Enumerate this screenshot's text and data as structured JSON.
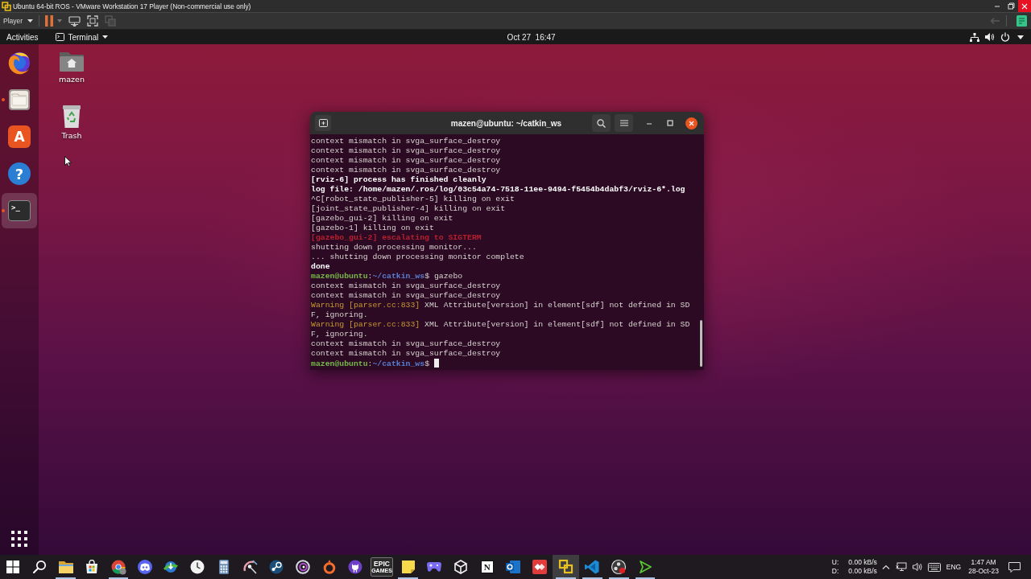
{
  "vm_window": {
    "title": "Ubuntu 64-bit ROS - VMware Workstation 17 Player (Non-commercial use only)"
  },
  "vm_toolbar": {
    "menu": "Player"
  },
  "top_bar": {
    "activities": "Activities",
    "app_menu": "Terminal",
    "clock": "Oct 27  16:47"
  },
  "dock": [
    {
      "kind": "browser",
      "running": false,
      "selected": false
    },
    {
      "kind": "files",
      "running": true,
      "selected": false
    },
    {
      "kind": "store",
      "glyph": "A",
      "running": false,
      "selected": false
    },
    {
      "kind": "help",
      "glyph": "?",
      "running": false,
      "selected": false
    },
    {
      "kind": "terminal",
      "glyph": ">_",
      "running": true,
      "selected": true
    }
  ],
  "desktop_icons": [
    {
      "kind": "home",
      "label": "mazen"
    },
    {
      "kind": "trash",
      "label": "Trash"
    }
  ],
  "terminal": {
    "title": "mazen@ubuntu: ~/catkin_ws",
    "lines": [
      {
        "segments": [
          {
            "kind": "output",
            "text": "context mismatch in svga_surface_destroy"
          }
        ]
      },
      {
        "segments": [
          {
            "kind": "output",
            "text": "context mismatch in svga_surface_destroy"
          }
        ]
      },
      {
        "segments": [
          {
            "kind": "output",
            "text": "context mismatch in svga_surface_destroy"
          }
        ]
      },
      {
        "segments": [
          {
            "kind": "output",
            "text": "context mismatch in svga_surface_destroy"
          }
        ]
      },
      {
        "segments": [
          {
            "kind": "bold",
            "text": "[rviz-6] process has finished cleanly"
          }
        ]
      },
      {
        "segments": [
          {
            "kind": "bold",
            "text": "log file: /home/mazen/.ros/log/03c54a74-7518-11ee-9494-f5454b4dabf3/rviz-6*.log"
          }
        ]
      },
      {
        "segments": [
          {
            "kind": "output",
            "text": "^C[robot_state_publisher-5] killing on exit"
          }
        ]
      },
      {
        "segments": [
          {
            "kind": "output",
            "text": "[joint_state_publisher-4] killing on exit"
          }
        ]
      },
      {
        "segments": [
          {
            "kind": "output",
            "text": "[gazebo_gui-2] killing on exit"
          }
        ]
      },
      {
        "segments": [
          {
            "kind": "output",
            "text": "[gazebo-1] killing on exit"
          }
        ]
      },
      {
        "segments": [
          {
            "kind": "error",
            "text": "[gazebo_gui-2] escalating to SIGTERM"
          }
        ]
      },
      {
        "segments": [
          {
            "kind": "output",
            "text": "shutting down processing monitor..."
          }
        ]
      },
      {
        "segments": [
          {
            "kind": "output",
            "text": "... shutting down processing monitor complete"
          }
        ]
      },
      {
        "segments": [
          {
            "kind": "bold",
            "text": "done"
          }
        ]
      },
      {
        "segments": [
          {
            "kind": "user",
            "text": "mazen@ubuntu"
          },
          {
            "kind": "output",
            "text": ":"
          },
          {
            "kind": "path",
            "text": "~/catkin_ws"
          },
          {
            "kind": "output",
            "text": "$ gazebo"
          }
        ]
      },
      {
        "segments": [
          {
            "kind": "output",
            "text": "context mismatch in svga_surface_destroy"
          }
        ]
      },
      {
        "segments": [
          {
            "kind": "output",
            "text": "context mismatch in svga_surface_destroy"
          }
        ]
      },
      {
        "segments": [
          {
            "kind": "warning",
            "text": "Warning [parser.cc:833]"
          },
          {
            "kind": "output",
            "text": " XML Attribute[version] in element[sdf] not defined in SDF, ignoring."
          }
        ]
      },
      {
        "segments": [
          {
            "kind": "warning",
            "text": "Warning [parser.cc:833]"
          },
          {
            "kind": "output",
            "text": " XML Attribute[version] in element[sdf] not defined in SDF, ignoring."
          }
        ]
      },
      {
        "segments": [
          {
            "kind": "output",
            "text": "context mismatch in svga_surface_destroy"
          }
        ]
      },
      {
        "segments": [
          {
            "kind": "output",
            "text": "context mismatch in svga_surface_destroy"
          }
        ]
      },
      {
        "segments": [
          {
            "kind": "user",
            "text": "mazen@ubuntu"
          },
          {
            "kind": "output",
            "text": ":"
          },
          {
            "kind": "path",
            "text": "~/catkin_ws"
          },
          {
            "kind": "output",
            "text": "$ "
          }
        ]
      }
    ]
  },
  "taskbar": {
    "apps": [
      {
        "kind": "start",
        "running": false,
        "selected": false
      },
      {
        "kind": "search",
        "running": false,
        "selected": false
      },
      {
        "kind": "folder",
        "running": true,
        "selected": false
      },
      {
        "kind": "bag",
        "running": false,
        "selected": false
      },
      {
        "kind": "wheel",
        "running": true,
        "selected": false
      },
      {
        "kind": "chat",
        "running": false,
        "selected": false
      },
      {
        "kind": "download",
        "running": false,
        "selected": false
      },
      {
        "kind": "clock",
        "running": false,
        "selected": false
      },
      {
        "kind": "calculator",
        "running": false,
        "selected": false
      },
      {
        "kind": "dish",
        "running": false,
        "selected": false
      },
      {
        "kind": "piston",
        "running": false,
        "selected": false
      },
      {
        "kind": "swirl",
        "running": false,
        "selected": false
      },
      {
        "kind": "ring",
        "running": false,
        "selected": false
      },
      {
        "kind": "emblem",
        "running": false,
        "selected": false
      },
      {
        "kind": "tile",
        "lines": [
          "EPIC",
          "GAMES"
        ],
        "running": false,
        "selected": false
      },
      {
        "kind": "note",
        "running": true,
        "selected": false
      },
      {
        "kind": "gamepad",
        "running": false,
        "selected": false
      },
      {
        "kind": "cube",
        "running": false,
        "selected": false
      },
      {
        "kind": "letter",
        "text": "N",
        "running": false,
        "selected": false
      },
      {
        "kind": "mail",
        "running": false,
        "selected": false
      },
      {
        "kind": "diamonds",
        "running": false,
        "selected": false
      },
      {
        "kind": "squares",
        "running": true,
        "selected": true
      },
      {
        "kind": "ribbon",
        "running": true,
        "selected": false
      },
      {
        "kind": "record",
        "running": true,
        "selected": false
      },
      {
        "kind": "arrow",
        "running": true,
        "selected": false
      }
    ],
    "tray": {
      "net_labels": [
        "U:",
        "D:"
      ],
      "net_rates": [
        "0.00 kB/s",
        "0.00 kB/s"
      ],
      "language": "ENG",
      "time": "1:47 AM",
      "date": "28-Oct-23"
    }
  }
}
